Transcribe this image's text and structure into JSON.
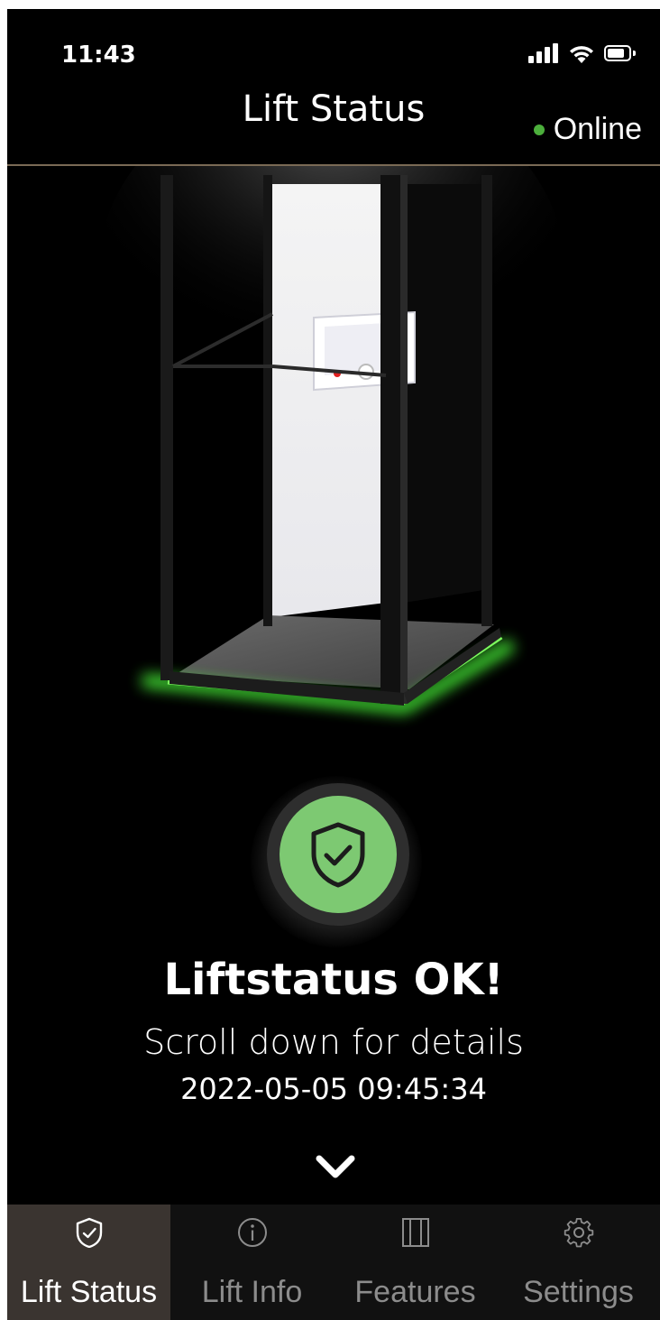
{
  "status_bar": {
    "time": "11:43",
    "icons": [
      "cellular-signal-icon",
      "wifi-icon",
      "battery-icon"
    ]
  },
  "header": {
    "title": "Lift Status",
    "connection_label": "Online",
    "connection_color": "#4caf3c",
    "divider_color": "#7a6a55"
  },
  "lift_image": {
    "icon": "platform-lift-illustration",
    "glow_color": "#4cff3a"
  },
  "status": {
    "icon": "shield-check-icon",
    "circle_color": "#7dc972",
    "title": "Liftstatus OK!",
    "subtitle": "Scroll down for details",
    "timestamp": "2022-05-05 09:45:34",
    "scroll_icon": "chevron-down-icon"
  },
  "tabs": [
    {
      "label": "Lift Status",
      "icon": "shield-check-icon",
      "active": true
    },
    {
      "label": "Lift Info",
      "icon": "info-icon",
      "active": false
    },
    {
      "label": "Features",
      "icon": "features-panel-icon",
      "active": false
    },
    {
      "label": "Settings",
      "icon": "gear-icon",
      "active": false
    }
  ]
}
